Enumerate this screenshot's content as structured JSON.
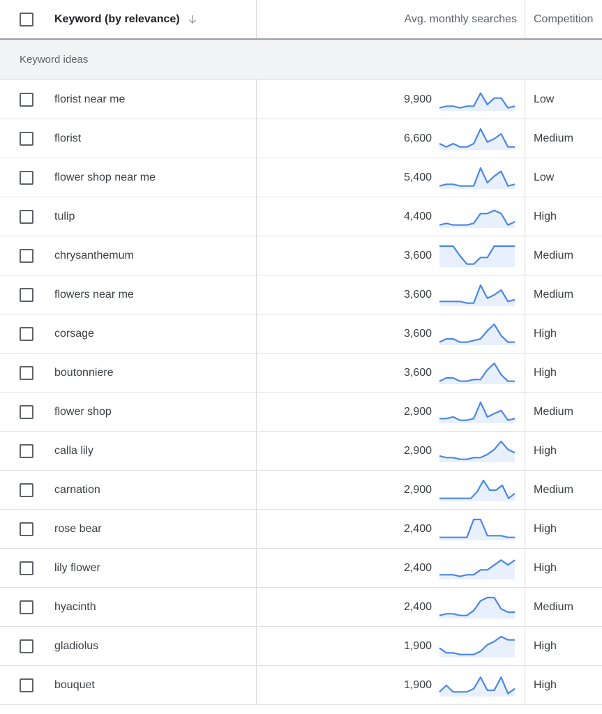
{
  "header": {
    "keyword_label": "Keyword (by relevance)",
    "sort_icon": "arrow-down-icon",
    "searches_label": "Avg. monthly searches",
    "competition_label": "Competition"
  },
  "section": {
    "label": "Keyword ideas"
  },
  "colors": {
    "sparkline_line": "#4a86e8",
    "sparkline_fill": "#e8f0fe",
    "section_bg": "#f1f3f4"
  },
  "rows": [
    {
      "keyword": "florist near me",
      "searches": "9,900",
      "competition": "Low",
      "trend": [
        2,
        4,
        4,
        2,
        4,
        4,
        20,
        6,
        14,
        14,
        2,
        4
      ]
    },
    {
      "keyword": "florist",
      "searches": "6,600",
      "competition": "Medium",
      "trend": [
        6,
        2,
        6,
        2,
        2,
        6,
        24,
        8,
        12,
        18,
        2,
        2
      ]
    },
    {
      "keyword": "flower shop near me",
      "searches": "5,400",
      "competition": "Low",
      "trend": [
        2,
        4,
        4,
        2,
        2,
        2,
        24,
        6,
        14,
        20,
        2,
        4
      ]
    },
    {
      "keyword": "tulip",
      "searches": "4,400",
      "competition": "High",
      "trend": [
        2,
        4,
        2,
        2,
        2,
        4,
        16,
        16,
        20,
        16,
        2,
        6
      ]
    },
    {
      "keyword": "chrysanthemum",
      "searches": "3,600",
      "competition": "Medium",
      "trend": [
        24,
        24,
        24,
        12,
        2,
        2,
        10,
        10,
        24,
        24,
        24,
        24
      ]
    },
    {
      "keyword": "flowers near me",
      "searches": "3,600",
      "competition": "Medium",
      "trend": [
        4,
        4,
        4,
        4,
        2,
        2,
        24,
        8,
        12,
        18,
        4,
        6
      ]
    },
    {
      "keyword": "corsage",
      "searches": "3,600",
      "competition": "High",
      "trend": [
        2,
        6,
        6,
        2,
        2,
        4,
        6,
        16,
        24,
        10,
        2,
        2
      ]
    },
    {
      "keyword": "boutonniere",
      "searches": "3,600",
      "competition": "High",
      "trend": [
        2,
        6,
        6,
        2,
        2,
        4,
        4,
        16,
        24,
        10,
        2,
        2
      ]
    },
    {
      "keyword": "flower shop",
      "searches": "2,900",
      "competition": "Medium",
      "trend": [
        4,
        4,
        6,
        2,
        2,
        4,
        24,
        6,
        10,
        14,
        2,
        4
      ]
    },
    {
      "keyword": "calla lily",
      "searches": "2,900",
      "competition": "High",
      "trend": [
        6,
        4,
        4,
        2,
        2,
        4,
        4,
        8,
        14,
        24,
        14,
        10
      ]
    },
    {
      "keyword": "carnation",
      "searches": "2,900",
      "competition": "Medium",
      "trend": [
        2,
        2,
        2,
        2,
        2,
        2,
        10,
        24,
        12,
        12,
        18,
        2,
        8
      ]
    },
    {
      "keyword": "rose bear",
      "searches": "2,400",
      "competition": "High",
      "trend": [
        2,
        2,
        2,
        2,
        2,
        24,
        24,
        4,
        4,
        4,
        2,
        2
      ]
    },
    {
      "keyword": "lily flower",
      "searches": "2,400",
      "competition": "High",
      "trend": [
        4,
        4,
        4,
        2,
        4,
        4,
        10,
        10,
        16,
        22,
        16,
        22
      ]
    },
    {
      "keyword": "hyacinth",
      "searches": "2,400",
      "competition": "Medium",
      "trend": [
        2,
        4,
        4,
        2,
        2,
        8,
        20,
        24,
        24,
        10,
        6,
        6
      ]
    },
    {
      "keyword": "gladiolus",
      "searches": "1,900",
      "competition": "High",
      "trend": [
        10,
        4,
        4,
        2,
        2,
        2,
        6,
        14,
        18,
        24,
        20,
        20
      ]
    },
    {
      "keyword": "bouquet",
      "searches": "1,900",
      "competition": "High",
      "trend": [
        4,
        12,
        4,
        4,
        4,
        8,
        22,
        6,
        6,
        22,
        2,
        8
      ]
    }
  ]
}
